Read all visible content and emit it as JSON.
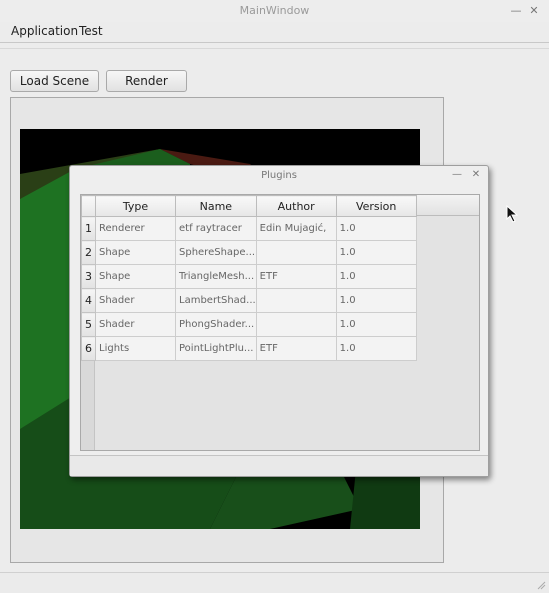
{
  "window": {
    "title": "MainWindow"
  },
  "menu": [
    "Application",
    "Test"
  ],
  "toolbar": {
    "load_scene": "Load Scene",
    "render": "Render"
  },
  "dialog": {
    "title": "Plugins",
    "columns": [
      "Type",
      "Name",
      "Author",
      "Version"
    ],
    "rows": [
      {
        "num": "1",
        "type": "Renderer",
        "name": "etf raytracer",
        "author": "Edin Mujagić,",
        "version": "1.0"
      },
      {
        "num": "2",
        "type": "Shape",
        "name": "SphereShape...",
        "author": "",
        "version": "1.0"
      },
      {
        "num": "3",
        "type": "Shape",
        "name": "TriangleMesh...",
        "author": "ETF",
        "version": "1.0"
      },
      {
        "num": "4",
        "type": "Shader",
        "name": "LambertShad...",
        "author": "",
        "version": "1.0"
      },
      {
        "num": "5",
        "type": "Shader",
        "name": "PhongShader...",
        "author": "",
        "version": "1.0"
      },
      {
        "num": "6",
        "type": "Lights",
        "name": "PointLightPlu...",
        "author": "ETF",
        "version": "1.0"
      }
    ]
  },
  "icons": {
    "minimize": "minimize-icon",
    "close": "close-icon",
    "cursor": "mouse-cursor-icon",
    "grip": "size-grip-icon"
  },
  "colors": {
    "render_background": "#000000",
    "scene_green": "#1d6a1e",
    "scene_red": "#5a1410"
  }
}
